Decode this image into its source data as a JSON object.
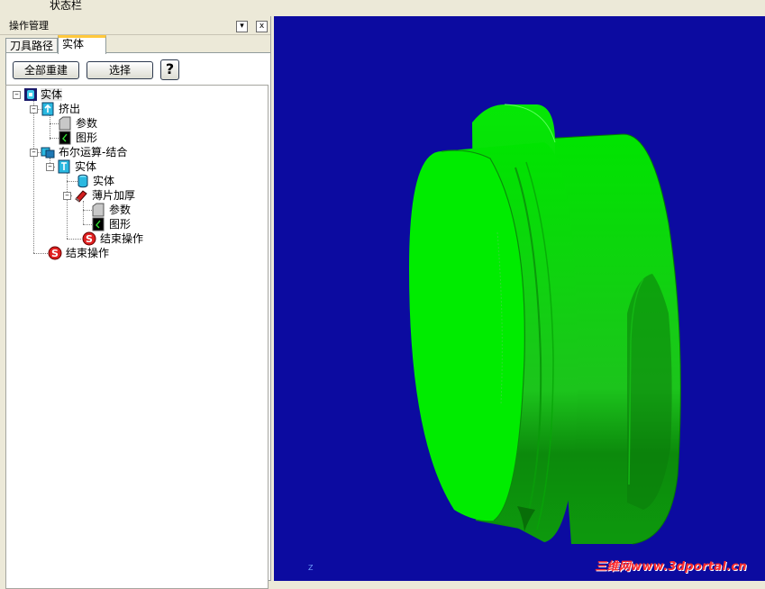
{
  "menubar": {
    "status_label": "状态栏"
  },
  "panel": {
    "title": "操作管理",
    "pin_glyph": "▾",
    "close_glyph": "x",
    "tabs": [
      {
        "label": "刀具路径",
        "active": false
      },
      {
        "label": "实体",
        "active": true
      }
    ],
    "buttons": {
      "regen_all": "全部重建",
      "select": "选择",
      "help": "?"
    }
  },
  "tree": {
    "root": {
      "label": "实体",
      "icon": "solids-root-icon"
    },
    "extrude": {
      "label": "挤出",
      "icon": "extrude-icon"
    },
    "extrude_params": {
      "label": "参数",
      "icon": "parameters-folder-icon"
    },
    "extrude_geometry": {
      "label": "图形",
      "icon": "geometry-icon"
    },
    "boolean_add": {
      "label": "布尔运算-结合",
      "icon": "boolean-add-icon"
    },
    "boolean_solid": {
      "label": "实体",
      "icon": "solid-icon"
    },
    "boolean_solid_child": {
      "label": "实体",
      "icon": "solid-icon"
    },
    "thicken": {
      "label": "薄片加厚",
      "icon": "thicken-icon"
    },
    "thicken_params": {
      "label": "参数",
      "icon": "parameters-folder-icon"
    },
    "thicken_geometry": {
      "label": "图形",
      "icon": "geometry-icon"
    },
    "boolean_stop": {
      "label": "结束操作",
      "icon": "stop-op-icon"
    },
    "root_stop": {
      "label": "结束操作",
      "icon": "stop-op-icon"
    }
  },
  "viewport": {
    "background": "#0c0ba0",
    "model_color": "#00e000",
    "axis_label": "Z",
    "watermark": "三维网www.3dportal.cn"
  }
}
